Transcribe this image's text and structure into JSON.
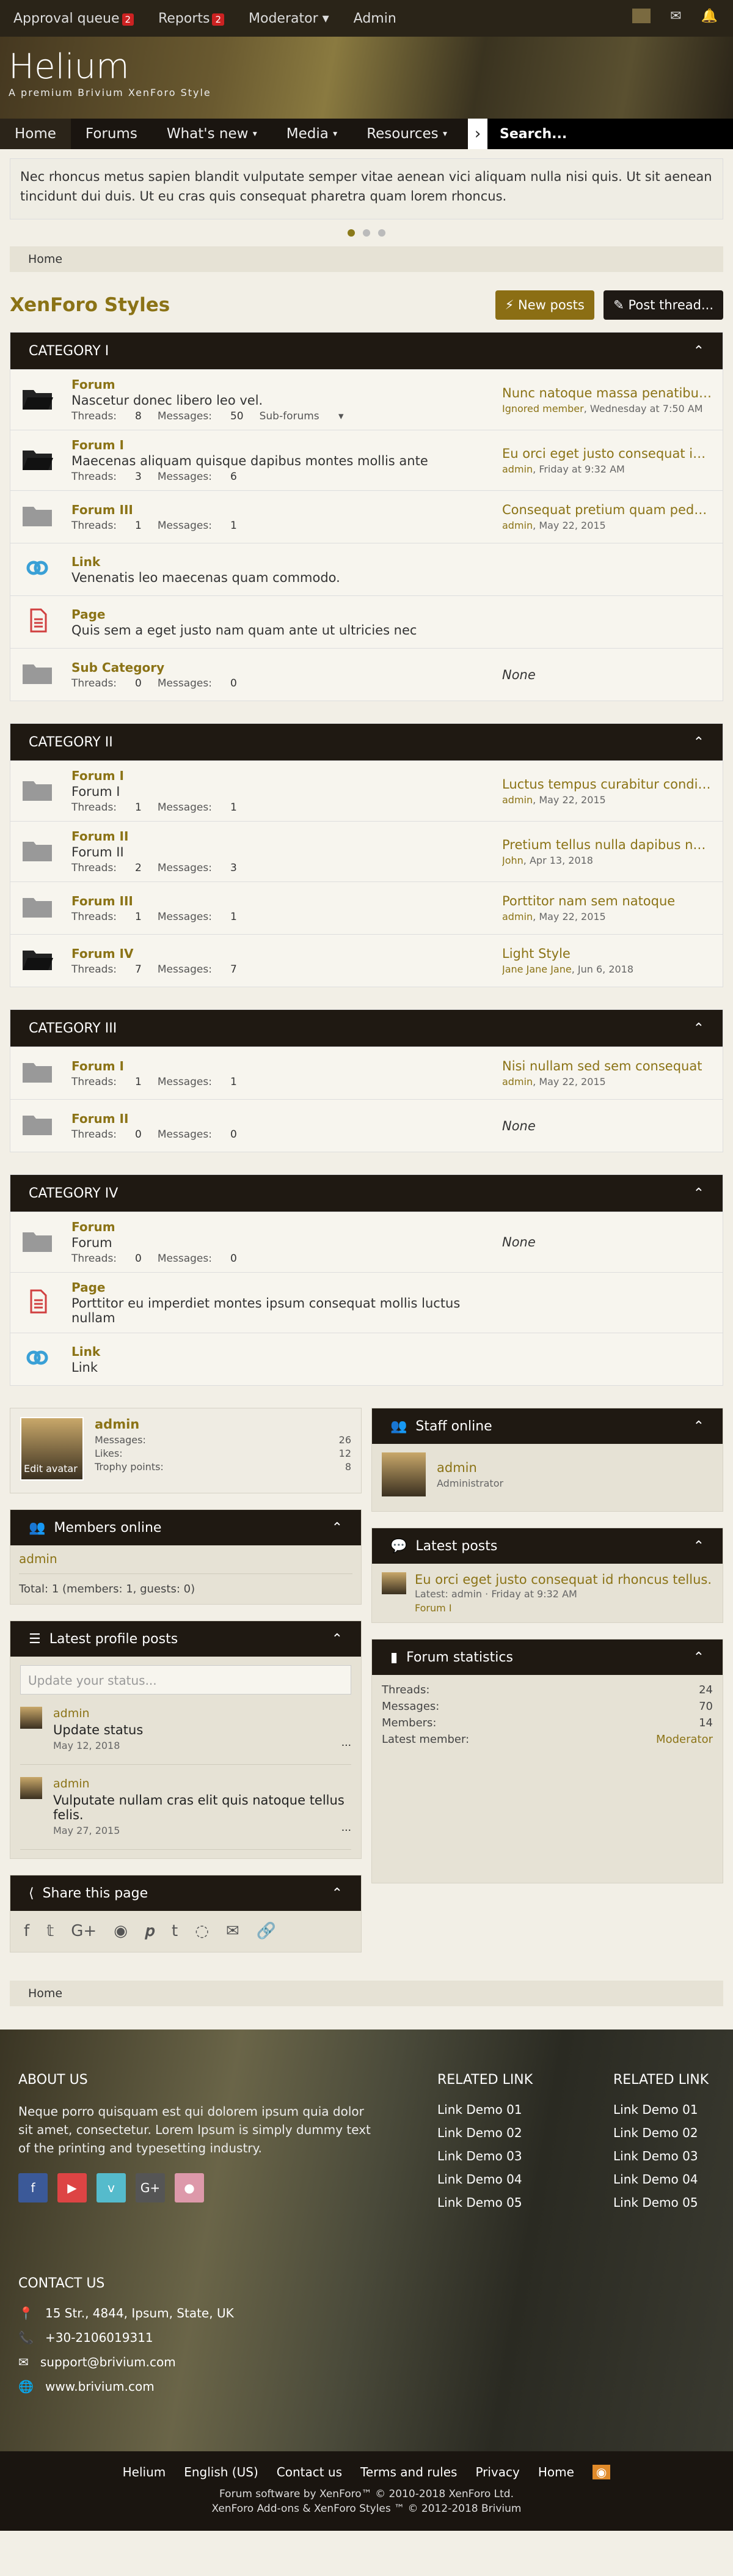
{
  "topbar": {
    "approval": "Approval queue",
    "approval_count": "2",
    "reports": "Reports",
    "reports_count": "2",
    "moderator": "Moderator",
    "admin": "Admin"
  },
  "site": {
    "logo": "Helium",
    "tagline": "A premium Brivium XenForo Style"
  },
  "nav": {
    "items": [
      "Home",
      "Forums",
      "What's new",
      "Media",
      "Resources"
    ],
    "search": "Search..."
  },
  "notice": {
    "text": "Nec rhoncus metus sapien blandit vulputate semper vitae aenean vici aliquam nulla nisi quis. Ut sit aenean tincidunt dui duis. Ut eu cras quis consequat pharetra quam lorem rhoncus."
  },
  "breadcrumb": "Home",
  "page": {
    "title": "XenForo Styles",
    "new_posts": "New posts",
    "post_thread": "Post thread..."
  },
  "categories": [
    {
      "title": "CATEGORY I",
      "nodes": [
        {
          "type": "folder-open",
          "title": "Forum",
          "desc": "Nascetur donec libero leo vel.",
          "threads": "8",
          "messages": "50",
          "sub": "Sub-forums",
          "last": "Nunc natoque massa penatibus l...",
          "meta_user": "Ignored member",
          "meta_date": "Wednesday at 7:50 AM"
        },
        {
          "type": "folder-open",
          "title": "Forum I",
          "desc": "Maecenas aliquam quisque dapibus montes mollis ante",
          "threads": "3",
          "messages": "6",
          "last": "Eu orci eget justo consequat id r...",
          "meta_user": "admin",
          "meta_date": "Friday at 9:32 AM"
        },
        {
          "type": "folder",
          "title": "Forum III",
          "desc": "",
          "threads": "1",
          "messages": "1",
          "last": "Consequat pretium quam pede li...",
          "meta_user": "admin",
          "meta_date": "May 22, 2015"
        },
        {
          "type": "link",
          "title": "Link",
          "desc": "Venenatis leo maecenas quam commodo."
        },
        {
          "type": "page",
          "title": "Page",
          "desc": "Quis sem a eget justo nam quam ante ut ultricies nec"
        },
        {
          "type": "folder",
          "title": "Sub Category",
          "desc": "",
          "threads": "0",
          "messages": "0",
          "none": "None"
        }
      ]
    },
    {
      "title": "CATEGORY II",
      "nodes": [
        {
          "type": "folder",
          "title": "Forum I",
          "desc": "Forum I",
          "threads": "1",
          "messages": "1",
          "last": "Luctus tempus curabitur condim...",
          "meta_user": "admin",
          "meta_date": "May 22, 2015"
        },
        {
          "type": "folder",
          "title": "Forum II",
          "desc": "Forum II",
          "threads": "2",
          "messages": "3",
          "last": "Pretium tellus nulla dapibus nec et",
          "meta_user": "John",
          "meta_date": "Apr 13, 2018"
        },
        {
          "type": "folder",
          "title": "Forum III",
          "desc": "",
          "threads": "1",
          "messages": "1",
          "last": "Porttitor nam sem natoque",
          "meta_user": "admin",
          "meta_date": "May 22, 2015"
        },
        {
          "type": "folder-open",
          "title": "Forum IV",
          "desc": "",
          "threads": "7",
          "messages": "7",
          "last": "Light Style",
          "meta_user": "Jane Jane Jane",
          "meta_date": "Jun 6, 2018"
        }
      ]
    },
    {
      "title": "CATEGORY III",
      "nodes": [
        {
          "type": "folder",
          "title": "Forum I",
          "desc": "",
          "threads": "1",
          "messages": "1",
          "last": "Nisi nullam sed sem consequat",
          "meta_user": "admin",
          "meta_date": "May 22, 2015"
        },
        {
          "type": "folder",
          "title": "Forum II",
          "desc": "",
          "threads": "0",
          "messages": "0",
          "none": "None"
        }
      ]
    },
    {
      "title": "CATEGORY IV",
      "nodes": [
        {
          "type": "folder",
          "title": "Forum",
          "desc": "Forum",
          "threads": "0",
          "messages": "0",
          "none": "None"
        },
        {
          "type": "page",
          "title": "Page",
          "desc": "Porttitor eu imperdiet montes ipsum consequat mollis luctus nullam"
        },
        {
          "type": "link",
          "title": "Link",
          "desc": "Link"
        }
      ]
    }
  ],
  "labels": {
    "threads": "Threads:",
    "messages": "Messages:"
  },
  "profile": {
    "name": "admin",
    "edit": "Edit avatar",
    "stats": [
      [
        "Messages:",
        "26"
      ],
      [
        "Likes:",
        "12"
      ],
      [
        "Trophy points:",
        "8"
      ]
    ]
  },
  "staff": {
    "title": "Staff online",
    "name": "admin",
    "role": "Administrator"
  },
  "members_online": {
    "title": "Members online",
    "user": "admin",
    "total": "Total: 1 (members: 1, guests: 0)"
  },
  "latest_posts": {
    "title": "Latest posts",
    "post": "Eu orci eget justo consequat id rhoncus tellus.",
    "meta": "Latest: admin · Friday at 9:32 AM",
    "forum": "Forum I"
  },
  "profile_posts": {
    "title": "Latest profile posts",
    "placeholder": "Update your status...",
    "items": [
      {
        "user": "admin",
        "text": "Update status",
        "date": "May 12, 2018"
      },
      {
        "user": "admin",
        "text": "Vulputate nullam cras elit quis natoque tellus felis.",
        "date": "May 27, 2015"
      }
    ]
  },
  "stats": {
    "title": "Forum statistics",
    "rows": [
      [
        "Threads:",
        "24"
      ],
      [
        "Messages:",
        "70"
      ],
      [
        "Members:",
        "14"
      ],
      [
        "Latest member:",
        "Moderator"
      ]
    ]
  },
  "share": {
    "title": "Share this page"
  },
  "footer": {
    "about_title": "ABOUT US",
    "about": "Neque porro quisquam est qui dolorem ipsum quia dolor sit amet, consectetur. Lorem Ipsum is simply dummy text of the printing and typesetting industry.",
    "related": "RELATED LINK",
    "links": [
      "Link Demo 01",
      "Link Demo 02",
      "Link Demo 03",
      "Link Demo 04",
      "Link Demo 05"
    ],
    "contact_title": "CONTACT US",
    "contact": [
      "15 Str., 4844, Ipsum, State, UK",
      "+30-2106019311",
      "support@brivium.com",
      "www.brivium.com"
    ],
    "bottom_links": [
      "Helium",
      "English (US)",
      "Contact us",
      "Terms and rules",
      "Privacy",
      "Home"
    ],
    "copyright1": "Forum software by XenForo™ © 2010-2018 XenForo Ltd.",
    "copyright2": "XenForo Add-ons & XenForo Styles ™ © 2012-2018 Brivium"
  },
  "colors": {
    "accent": "#8b7316",
    "dark": "#1f1912",
    "badge": "#cc2222"
  }
}
